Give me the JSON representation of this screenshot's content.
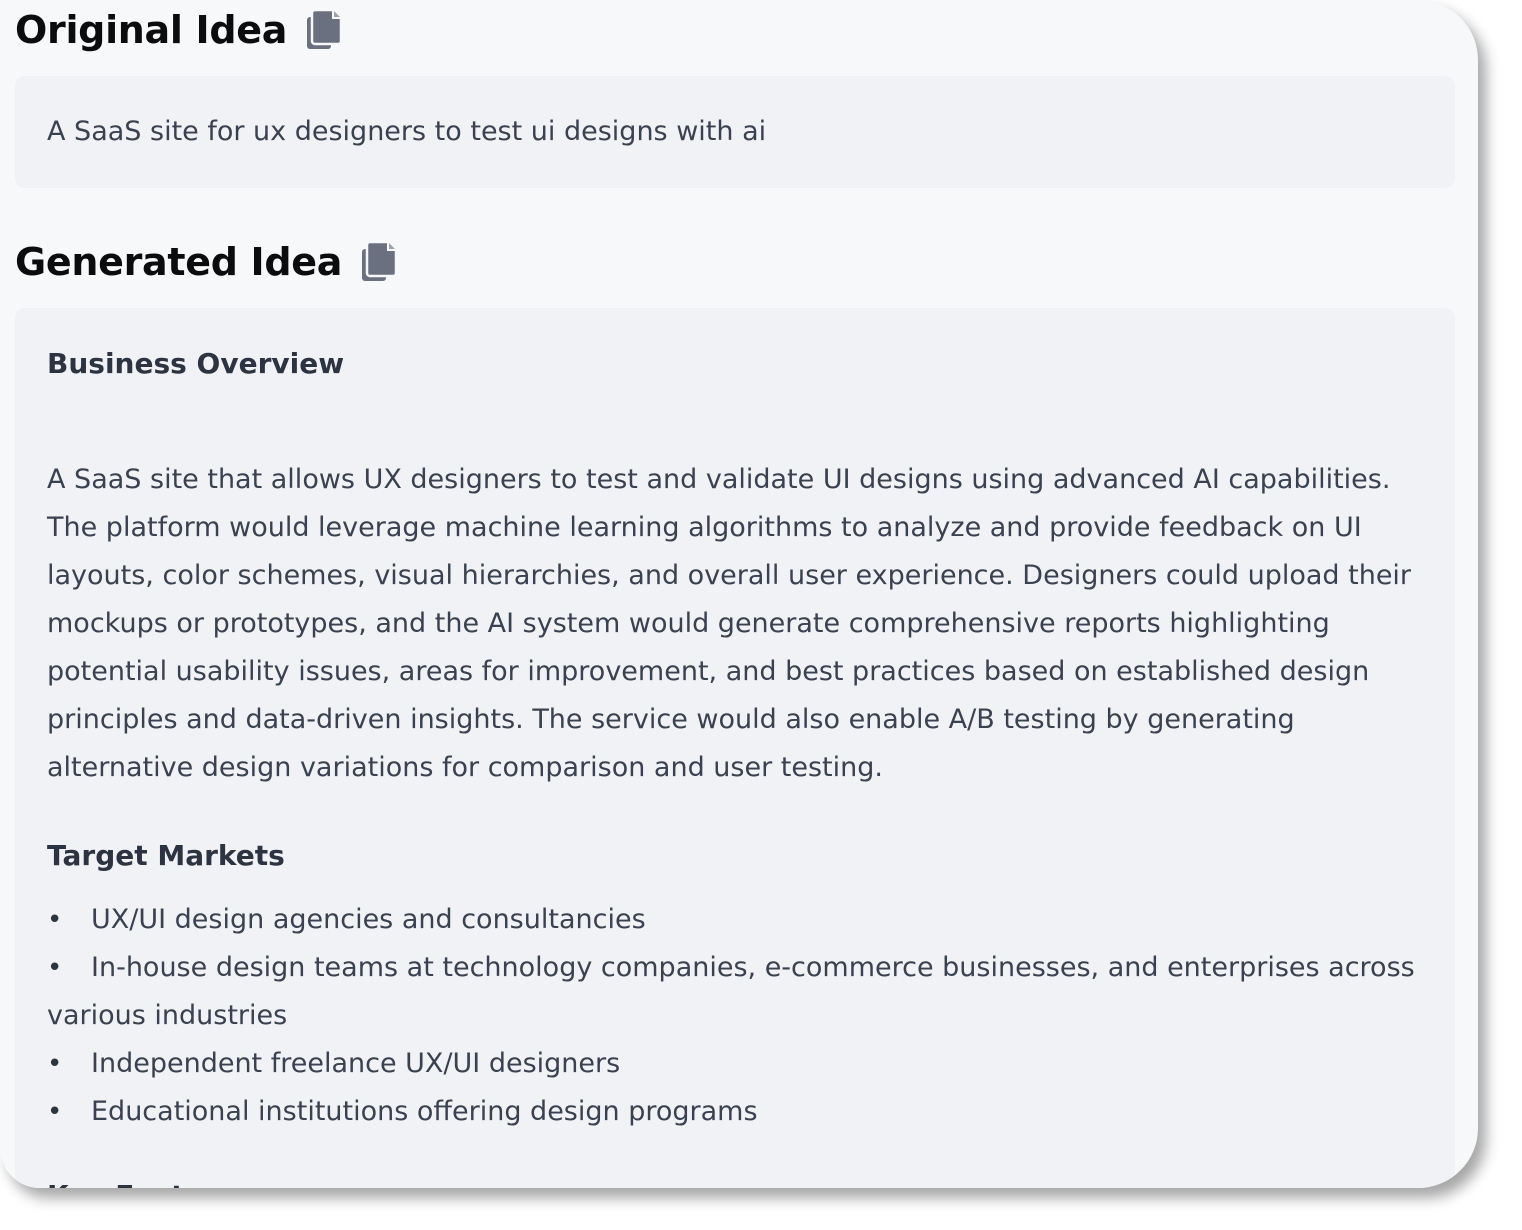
{
  "original": {
    "heading": "Original Idea",
    "text": "A SaaS site for ux designers to test ui designs with ai"
  },
  "generated": {
    "heading": "Generated Idea",
    "overview_heading": "Business Overview",
    "overview_text": "A SaaS site that allows UX designers to test and validate UI designs using advanced AI capabilities. The platform would leverage machine learning algorithms to analyze and provide feedback on UI layouts, color schemes, visual hierarchies, and overall user experience. Designers could upload their mockups or prototypes, and the AI system would generate comprehensive reports highlighting potential usability issues, areas for improvement, and best practices based on established design principles and data-driven insights. The service would also enable A/B testing by generating alternative design variations for comparison and user testing.",
    "markets_heading": "Target Markets",
    "markets": [
      "UX/UI design agencies and consultancies",
      "In-house design teams at technology companies, e-commerce businesses, and enterprises across various industries",
      "Independent freelance UX/UI designers",
      "Educational institutions offering design programs"
    ],
    "features_heading": "Key Features"
  },
  "icons": {
    "copy": "copy-icon",
    "bullet": "•"
  },
  "colors": {
    "page_bg": "#f7f8fa",
    "card_bg": "#f1f2f5",
    "heading": "#0b0c0e",
    "text": "#3a4150",
    "icon": "#6b7080"
  }
}
